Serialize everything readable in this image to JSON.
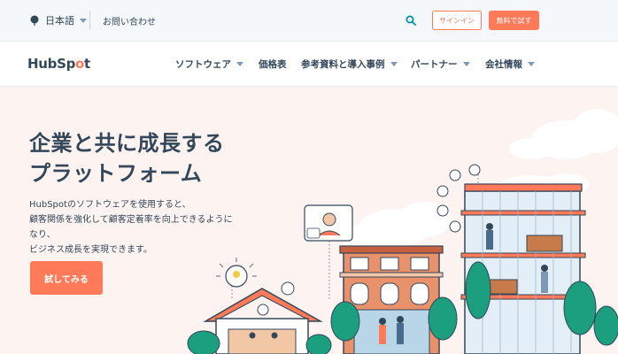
{
  "utility": {
    "language": "日本語",
    "contact": "お問い合わせ",
    "signin": "サインイン",
    "free_trial": "無料で試す"
  },
  "nav": {
    "logo": "HubSpot",
    "items": [
      {
        "label": "ソフトウェア",
        "has_caret": true
      },
      {
        "label": "価格表",
        "has_caret": false
      },
      {
        "label": "参考資料と導入事例",
        "has_caret": true
      },
      {
        "label": "パートナー",
        "has_caret": true
      },
      {
        "label": "会社情報",
        "has_caret": true
      }
    ]
  },
  "hero": {
    "headline_line1": "企業と共に成長する",
    "headline_line2": "プラットフォーム",
    "sub_line1": "HubSpotのソフトウェアを使用すると、",
    "sub_line2": "顧客関係を強化して顧客定着率を向上できるように",
    "sub_line3": "なり、",
    "sub_line4": "ビジネス成長を実現できます。",
    "cta": "試してみる"
  },
  "colors": {
    "accent": "#ff7a59",
    "text": "#33475b",
    "hero_bg": "#fdf3f0",
    "search_icon": "#0091ae"
  }
}
